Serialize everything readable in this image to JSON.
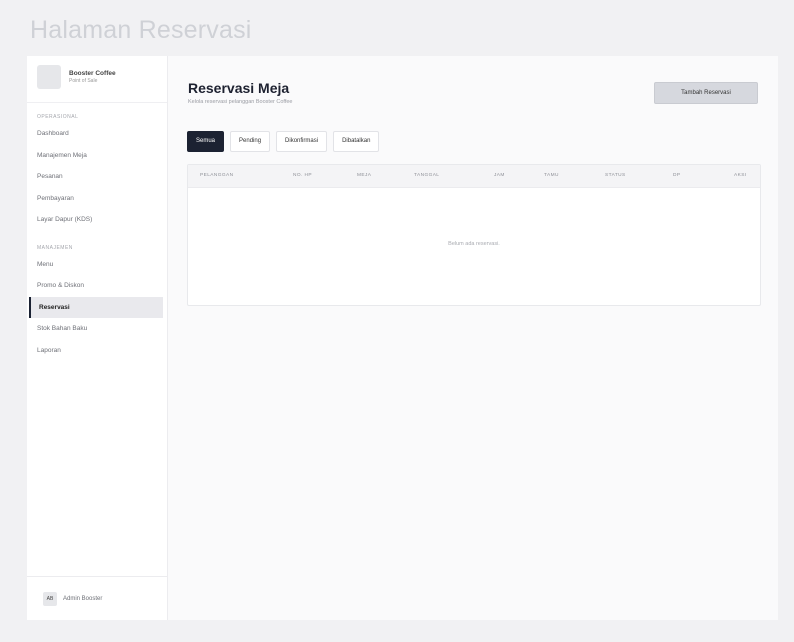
{
  "page_heading": "Halaman Reservasi",
  "brand": {
    "name": "Booster Coffee",
    "subtitle": "Point of Sale"
  },
  "sidebar": {
    "section_1": "OPERASIONAL",
    "items_1": [
      "Dashboard",
      "Manajemen Meja",
      "Pesanan",
      "Pembayaran",
      "Layar Dapur (KDS)"
    ],
    "section_2": "MANAJEMEN",
    "items_2": [
      "Menu",
      "Promo & Diskon",
      "Reservasi",
      "Stok Bahan Baku",
      "Laporan"
    ],
    "active_item": "Reservasi"
  },
  "user": {
    "initials": "AB",
    "name": "Admin Booster"
  },
  "main": {
    "title": "Reservasi Meja",
    "subtitle": "Kelola reservasi pelanggan Booster Coffee",
    "add_button": "Tambah Reservasi",
    "tabs": [
      "Semua",
      "Pending",
      "Dikonfirmasi",
      "Dibatalkan"
    ],
    "active_tab": "Semua",
    "table": {
      "headers": [
        "PELANGGAN",
        "NO. HP",
        "MEJA",
        "TANGGAL",
        "JAM",
        "TAMU",
        "STATUS",
        "DP",
        "AKSI"
      ],
      "empty_message": "Belum ada reservasi."
    }
  }
}
